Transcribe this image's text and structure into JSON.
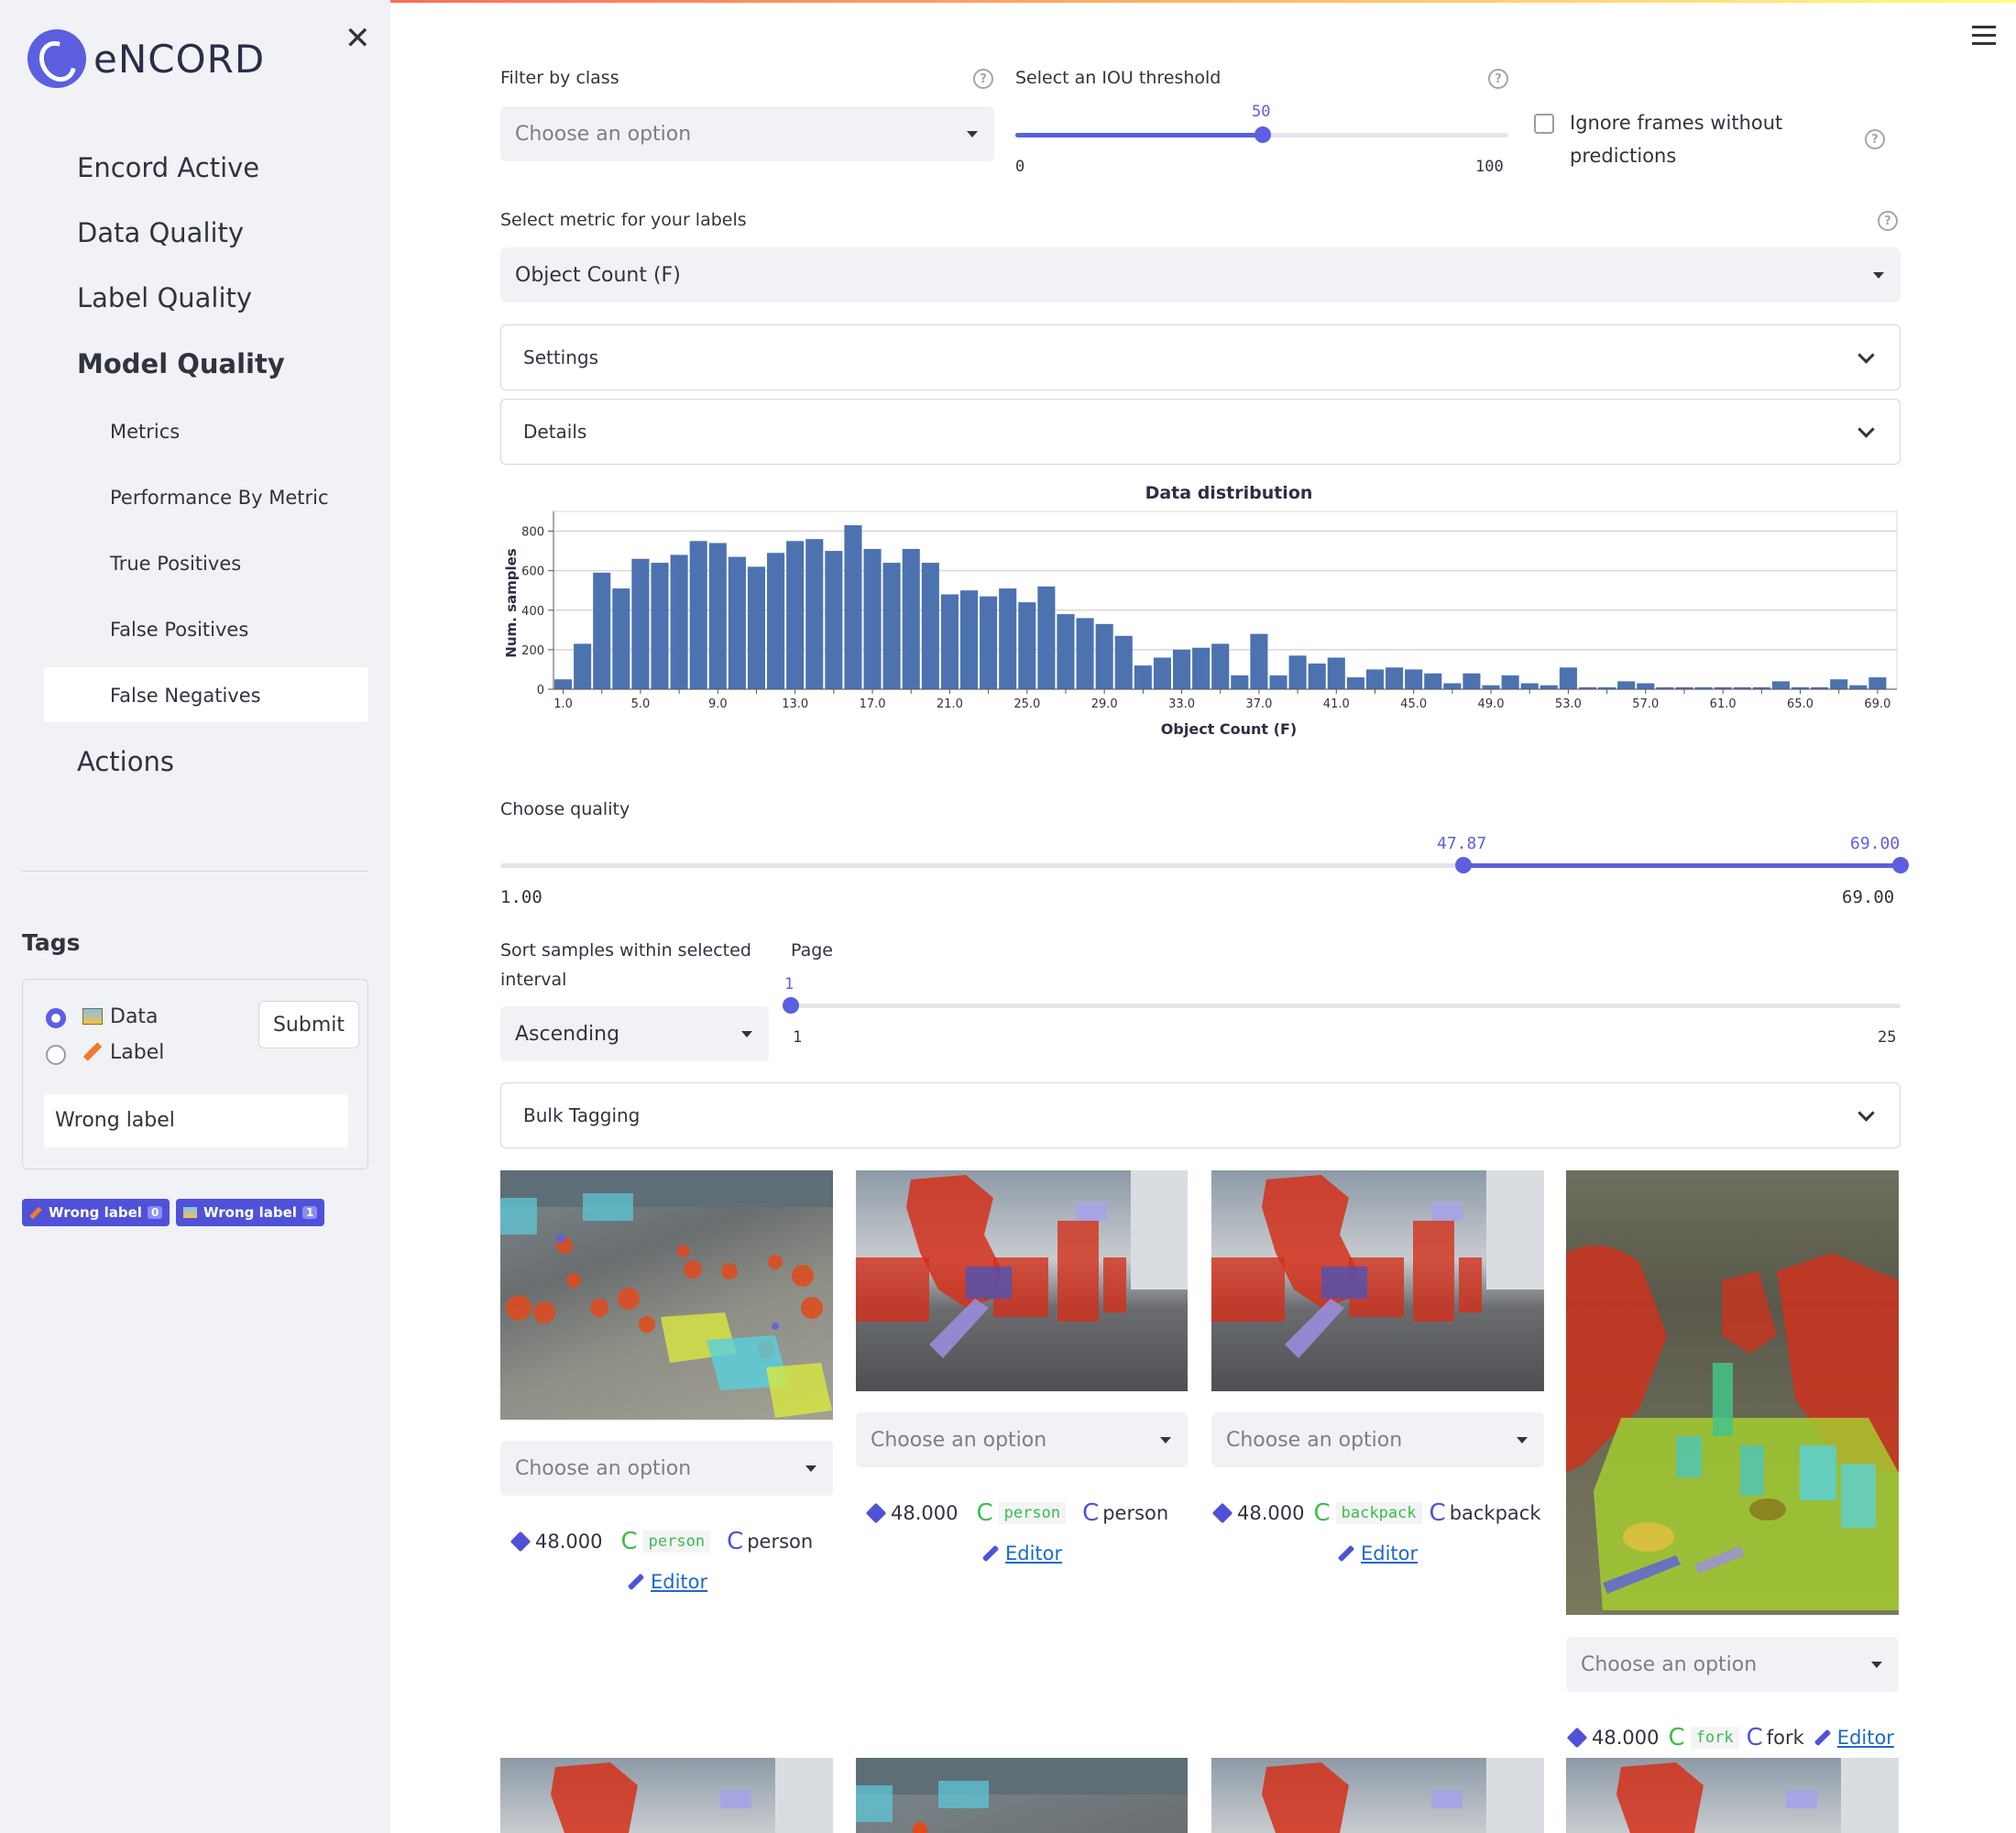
{
  "sidebar": {
    "logo_text": "eNCORD",
    "nav": [
      "Encord Active",
      "Data Quality",
      "Label Quality",
      "Model Quality"
    ],
    "model_quality_subitems": [
      "Metrics",
      "Performance By Metric",
      "True Positives",
      "False Positives",
      "False Negatives"
    ],
    "actions": "Actions",
    "tags": {
      "title": "Tags",
      "options": [
        "Data",
        "Label"
      ],
      "selected": "Data",
      "submit": "Submit",
      "input_value": "Wrong label",
      "chips": [
        {
          "label": "Wrong label",
          "count": "0"
        },
        {
          "label": "Wrong label",
          "count": "1"
        }
      ]
    }
  },
  "filters": {
    "filter_by_class_label": "Filter by class",
    "filter_by_class_placeholder": "Choose an option",
    "iou_label": "Select an IOU threshold",
    "iou_value": "50",
    "iou_min": "0",
    "iou_max": "100",
    "iou_fraction": 0.5,
    "ignore_frames_label_1": "Ignore frames without",
    "ignore_frames_label_2": "predictions",
    "metric_label": "Select metric for your labels",
    "metric_value": "Object Count (F)"
  },
  "expanders": {
    "settings": "Settings",
    "details": "Details",
    "bulk_tagging": "Bulk Tagging"
  },
  "chart_data": {
    "type": "bar",
    "title": "Data distribution",
    "xlabel": "Object Count (F)",
    "ylabel": "Num. samples",
    "ylim": [
      0,
      900
    ],
    "xlim": [
      0.5,
      70
    ],
    "x_ticks": [
      "1.0",
      "5.0",
      "9.0",
      "13.0",
      "17.0",
      "21.0",
      "25.0",
      "29.0",
      "33.0",
      "37.0",
      "41.0",
      "45.0",
      "49.0",
      "53.0",
      "57.0",
      "61.0",
      "65.0",
      "69.0"
    ],
    "y_ticks": [
      0,
      200,
      400,
      600,
      800
    ],
    "x": [
      1,
      2,
      3,
      4,
      5,
      6,
      7,
      8,
      9,
      10,
      11,
      12,
      13,
      14,
      15,
      16,
      17,
      18,
      19,
      20,
      21,
      22,
      23,
      24,
      25,
      26,
      27,
      28,
      29,
      30,
      31,
      32,
      33,
      34,
      35,
      36,
      37,
      38,
      39,
      40,
      41,
      42,
      43,
      44,
      45,
      46,
      47,
      48,
      49,
      50,
      51,
      52,
      53,
      54,
      55,
      56,
      57,
      58,
      59,
      60,
      61,
      62,
      63,
      64,
      65,
      66,
      67,
      68,
      69
    ],
    "values": [
      50,
      230,
      590,
      510,
      660,
      640,
      680,
      750,
      740,
      670,
      620,
      690,
      750,
      760,
      700,
      830,
      710,
      640,
      710,
      640,
      480,
      500,
      470,
      510,
      440,
      520,
      380,
      360,
      330,
      270,
      120,
      160,
      200,
      210,
      230,
      70,
      280,
      70,
      170,
      130,
      160,
      60,
      100,
      110,
      100,
      80,
      30,
      80,
      20,
      70,
      30,
      20,
      110,
      10,
      10,
      40,
      30,
      10,
      10,
      10,
      10,
      10,
      10,
      40,
      10,
      10,
      50,
      20,
      60
    ],
    "grid": true
  },
  "quality": {
    "label": "Choose quality",
    "low_value": "47.87",
    "high_value": "69.00",
    "min": "1.00",
    "max": "69.00",
    "low_fraction": 0.689,
    "high_fraction": 1.0
  },
  "sort": {
    "label_1": "Sort samples within selected",
    "label_2": "interval",
    "value": "Ascending"
  },
  "page": {
    "label": "Page",
    "value": "1",
    "min": "1",
    "max": "25",
    "fraction": 0
  },
  "cards": [
    {
      "select_placeholder": "Choose an option",
      "score": "48.000",
      "class_code": "person",
      "class_name": "person",
      "editor": "Editor"
    },
    {
      "select_placeholder": "Choose an option",
      "score": "48.000",
      "class_code": "person",
      "class_name": "person",
      "editor": "Editor"
    },
    {
      "select_placeholder": "Choose an option",
      "score": "48.000",
      "class_code": "backpack",
      "class_name": "backpack",
      "editor": "Editor"
    },
    {
      "select_placeholder": "Choose an option",
      "score": "48.000",
      "class_code": "fork",
      "class_name": "fork",
      "editor": "Editor"
    }
  ],
  "colors": {
    "accent": "#5b5fe0",
    "bar": "#4c72b0",
    "sidebar_bg": "#f0f2f6",
    "link": "#1c69c9",
    "class_green": "#3bbd4a"
  }
}
